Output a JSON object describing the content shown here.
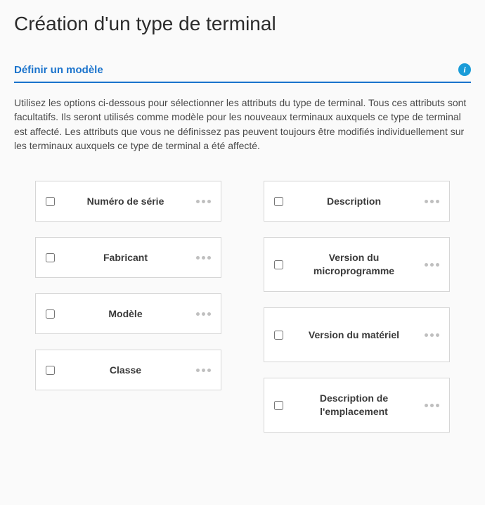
{
  "page_title": "Création d'un type de terminal",
  "section_title": "Définir un modèle",
  "info_glyph": "i",
  "description": "Utilisez les options ci-dessous pour sélectionner les attributs du type de terminal. Tous ces attributs sont facultatifs. Ils seront utilisés comme modèle pour les nouveaux terminaux auxquels ce type de terminal est affecté. Les attributs que vous ne définissez pas peuvent toujours être modifiés individuellement sur les terminaux auxquels ce type de terminal a été affecté.",
  "left_cards": [
    {
      "label": "Numéro de série"
    },
    {
      "label": "Fabricant"
    },
    {
      "label": "Modèle"
    },
    {
      "label": "Classe"
    }
  ],
  "right_cards": [
    {
      "label": "Description"
    },
    {
      "label": "Version du microprogramme",
      "tall": true
    },
    {
      "label": "Version du matériel",
      "tall": true
    },
    {
      "label": "Description de l'emplacement",
      "tall": true
    }
  ]
}
